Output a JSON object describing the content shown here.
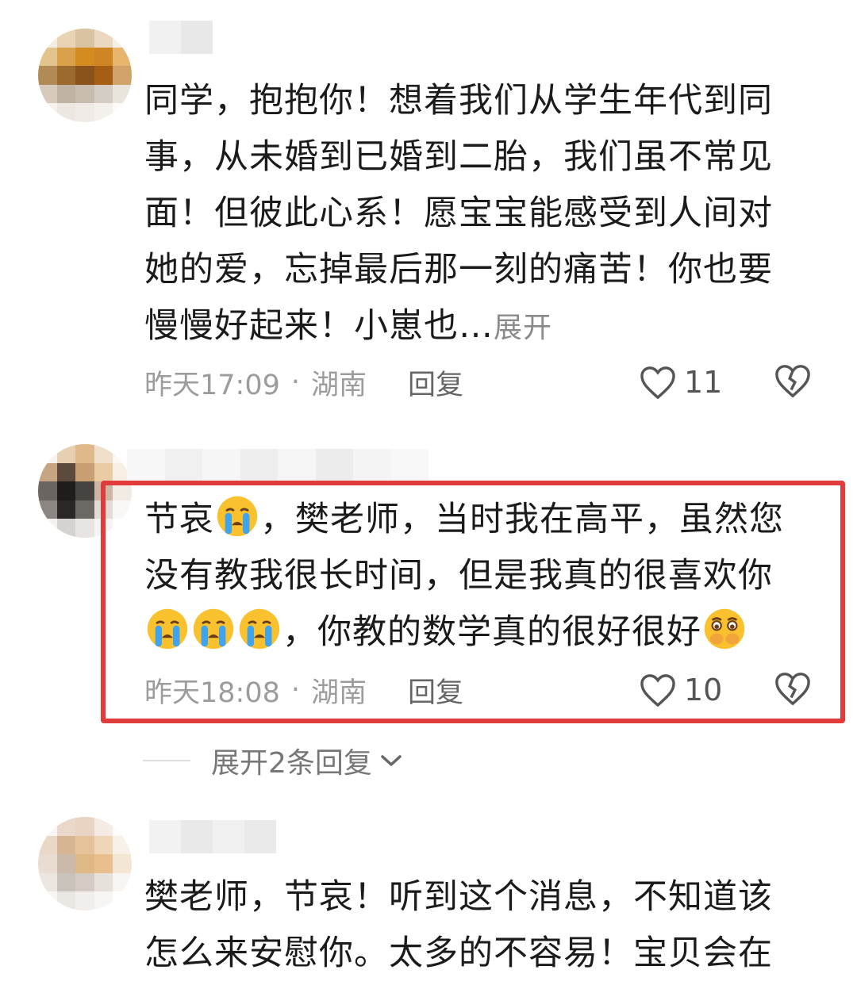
{
  "comments": [
    {
      "text": "同学，抱抱你！想着我们从学生年代到同事，从未婚到已婚到二胎，我们虽不常见面！但彼此心系！愿宝宝能感受到人间对她的爱，忘掉最后那一刻的痛苦！你也要慢慢好起来！小崽也…",
      "expand_label": "展开",
      "time": "昨天17:09",
      "location": "湖南",
      "reply_label": "回复",
      "likes": "11"
    },
    {
      "text_1": "节哀",
      "text_2": "，樊老师，当时我在高平，虽然您没有教我很长时间，但是我真的很喜欢你",
      "text_3": "，你教的数学真的很好很好",
      "time": "昨天18:08",
      "location": "湖南",
      "reply_label": "回复",
      "likes": "10",
      "show_replies_label": "展开2条回复"
    },
    {
      "text": "樊老师，节哀！听到这个消息，不知道该怎么来安慰你。太多的不容易！宝贝会在"
    }
  ],
  "separator": "·",
  "colors": {
    "highlight_border": "#e23b3b",
    "meta_text": "#9c9c9c"
  },
  "icons": [
    "heart-icon",
    "broken-heart-icon",
    "crying-emoji",
    "holding-back-tears-emoji",
    "chevron-down-icon"
  ]
}
